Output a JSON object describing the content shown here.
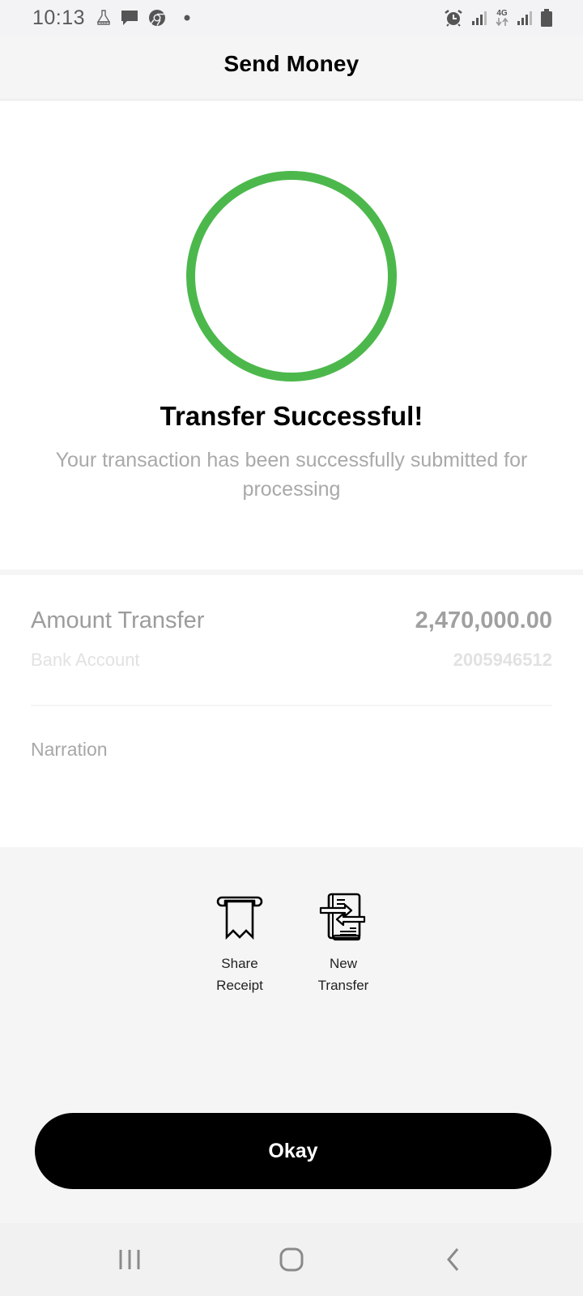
{
  "status_bar": {
    "time": "10:13",
    "left_icons": [
      "cleaner-icon",
      "message-icon",
      "chrome-icon",
      "notification-dot-icon"
    ],
    "right_icons": [
      "alarm-icon",
      "signal-icon",
      "network-4g-icon",
      "signal-icon",
      "battery-icon"
    ],
    "network_label": "4G"
  },
  "header": {
    "title": "Send Money"
  },
  "success": {
    "title": "Transfer Successful!",
    "message": "Your transaction has been successfully submitted for processing",
    "ring_color": "#4cb84c"
  },
  "details": {
    "amount_label": "Amount Transfer",
    "amount_value": "2,470,000.00",
    "account_label": "Bank Account",
    "account_value": "2005946512",
    "narration_label": "Narration"
  },
  "actions": [
    {
      "label": "Share Receipt",
      "icon": "receipt-icon"
    },
    {
      "label": "New Transfer",
      "icon": "transfer-document-icon"
    }
  ],
  "okay_button": {
    "label": "Okay"
  },
  "nav_bar": {
    "buttons": [
      "recent-apps-icon",
      "home-icon",
      "back-icon"
    ]
  }
}
